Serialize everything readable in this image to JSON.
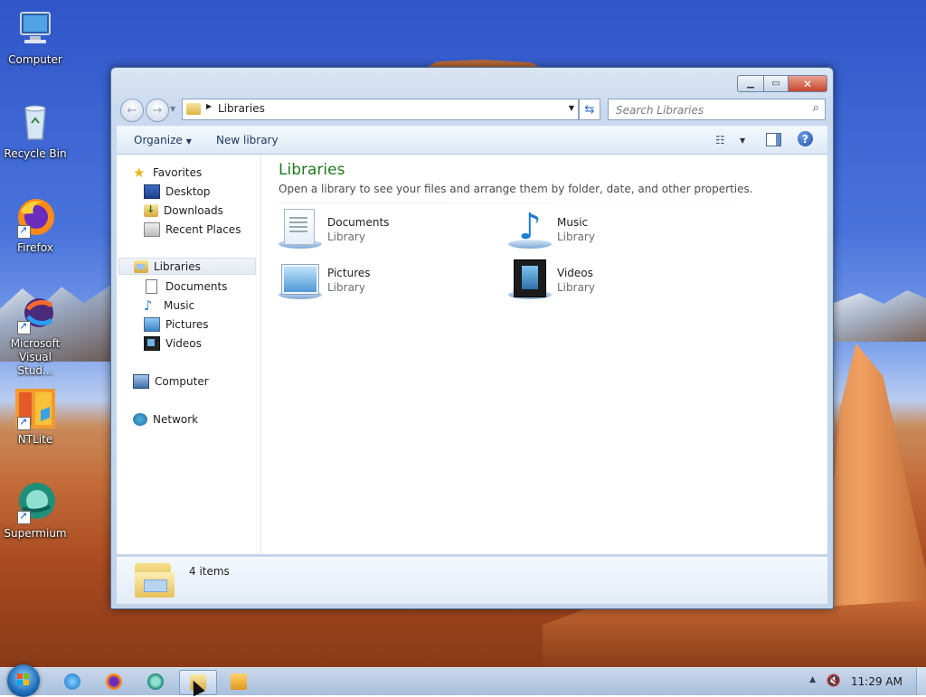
{
  "desktop": {
    "icons": [
      {
        "label": "Computer"
      },
      {
        "label": "Recycle Bin"
      },
      {
        "label": "Firefox"
      },
      {
        "label": "Microsoft Visual Stud..."
      },
      {
        "label": "NTLite"
      },
      {
        "label": "Supermium"
      }
    ]
  },
  "window": {
    "address": {
      "crumb": "Libraries"
    },
    "search": {
      "placeholder": "Search Libraries"
    },
    "toolbar": {
      "organize": "Organize",
      "new_library": "New library"
    },
    "nav": {
      "favorites": {
        "label": "Favorites",
        "items": [
          "Desktop",
          "Downloads",
          "Recent Places"
        ]
      },
      "libraries": {
        "label": "Libraries",
        "items": [
          "Documents",
          "Music",
          "Pictures",
          "Videos"
        ]
      },
      "computer": "Computer",
      "network": "Network"
    },
    "content": {
      "title": "Libraries",
      "description": "Open a library to see your files and arrange them by folder, date, and other properties.",
      "libraries": [
        {
          "name": "Documents",
          "type": "Library"
        },
        {
          "name": "Music",
          "type": "Library"
        },
        {
          "name": "Pictures",
          "type": "Library"
        },
        {
          "name": "Videos",
          "type": "Library"
        }
      ]
    },
    "details": {
      "count": "4 items"
    }
  },
  "taskbar": {
    "clock": "11:29 AM"
  }
}
